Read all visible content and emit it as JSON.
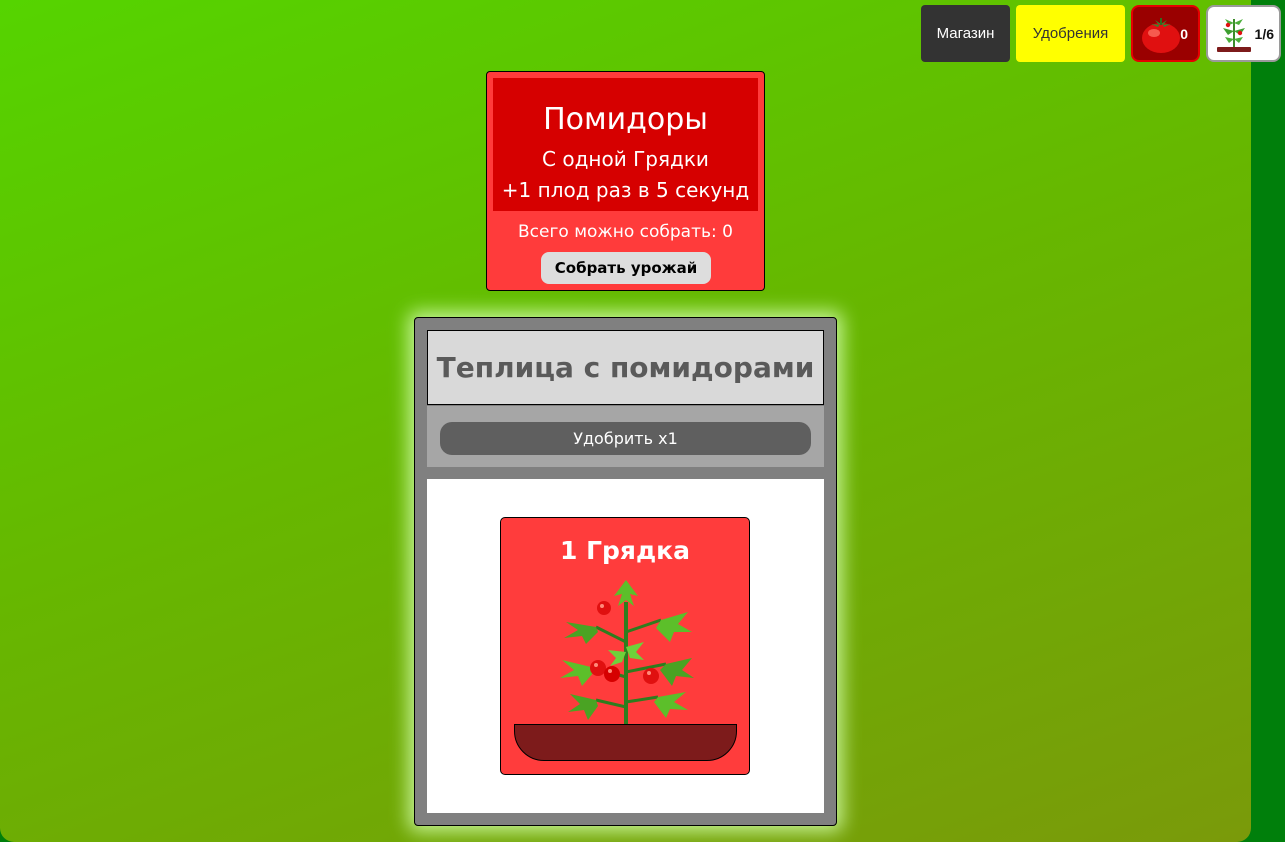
{
  "toolbar": {
    "shop_label": "Магазин",
    "fertilizers_label": "Удобрения",
    "tomato_count": "0",
    "beds_count": "1/6"
  },
  "info_card": {
    "title": "Помидоры",
    "line1": "С одной Грядки",
    "line2": "+1 плод раз в 5 секунд",
    "total": "Всего можно собрать: 0",
    "harvest_label": "Собрать урожай"
  },
  "greenhouse": {
    "title": "Теплица с помидорами",
    "fertilize_label": "Удобрить x1",
    "beds": [
      {
        "label": "1 Грядка"
      }
    ]
  },
  "colors": {
    "field": "#55d400",
    "card_red": "#ff3b3b",
    "card_header": "#d60000",
    "soil": "#7d1b1b",
    "fertilizer_button": "#ffff00",
    "shop_button": "#333333"
  },
  "icons": {
    "tomato_counter": "tomato-icon",
    "beds_counter": "plant-bed-icon",
    "bed_plant": "tomato-plant-icon"
  }
}
